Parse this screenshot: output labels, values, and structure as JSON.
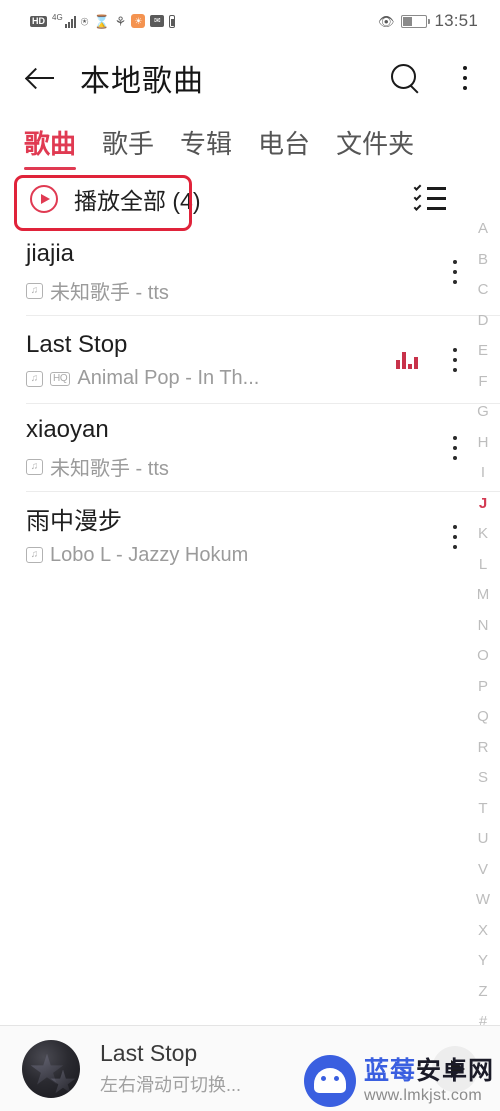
{
  "status_bar": {
    "hd_label": "HD",
    "network_label": "4G",
    "icons": [
      "hd-icon",
      "4g-icon",
      "signal-bars-icon",
      "wifi-icon",
      "hourglass-icon",
      "alarm-icon",
      "orange-app-icon",
      "mail-icon",
      "battery-small-icon"
    ],
    "eye_icon": "eye-comfort-icon",
    "time": "13:51"
  },
  "app_bar": {
    "back_label": "←",
    "title": "本地歌曲",
    "search_icon": "search-icon",
    "menu_icon": "kebab-menu-icon"
  },
  "tabs": [
    {
      "label": "歌曲",
      "active": true
    },
    {
      "label": "歌手",
      "active": false
    },
    {
      "label": "专辑",
      "active": false
    },
    {
      "label": "电台",
      "active": false
    },
    {
      "label": "文件夹",
      "active": false
    }
  ],
  "play_all": {
    "label": "播放全部 (4)",
    "count": 4,
    "play_icon": "play-circle-icon",
    "multiselect_icon": "checklist-icon",
    "highlight_color": "#e0233a"
  },
  "songs": [
    {
      "title": "jiajia",
      "subtitle": "未知歌手 - tts",
      "local_badge": "local-file-icon",
      "hq_badge": "",
      "playing": false
    },
    {
      "title": "Last Stop",
      "subtitle": "Animal Pop - In Th...",
      "local_badge": "local-file-icon",
      "hq_badge": "HQ",
      "playing": true
    },
    {
      "title": "xiaoyan",
      "subtitle": "未知歌手 - tts",
      "local_badge": "local-file-icon",
      "hq_badge": "",
      "playing": false
    },
    {
      "title": "雨中漫步",
      "subtitle": "Lobo L - Jazzy Hokum",
      "local_badge": "local-file-icon",
      "hq_badge": "",
      "playing": false
    }
  ],
  "alpha_index": {
    "letters": [
      "A",
      "B",
      "C",
      "D",
      "E",
      "F",
      "G",
      "H",
      "I",
      "J",
      "K",
      "L",
      "M",
      "N",
      "O",
      "P",
      "Q",
      "R",
      "S",
      "T",
      "U",
      "V",
      "W",
      "X",
      "Y",
      "Z",
      "#"
    ],
    "selected": "J",
    "selected_color": "#d33a52"
  },
  "player": {
    "album_art": "album-art-thumbnail",
    "title": "Last Stop",
    "subtitle": "左右滑动可切换...",
    "play_icon": "play-button-icon"
  },
  "watermark": {
    "logo": "android-robot-logo",
    "brand_blue": "蓝莓",
    "brand_dark": "安卓网",
    "url": "www.lmkjst.com"
  },
  "theme": {
    "accent": "#e03a52",
    "annotation": "#e0233a",
    "watermark_blue": "#3a5fe0"
  }
}
